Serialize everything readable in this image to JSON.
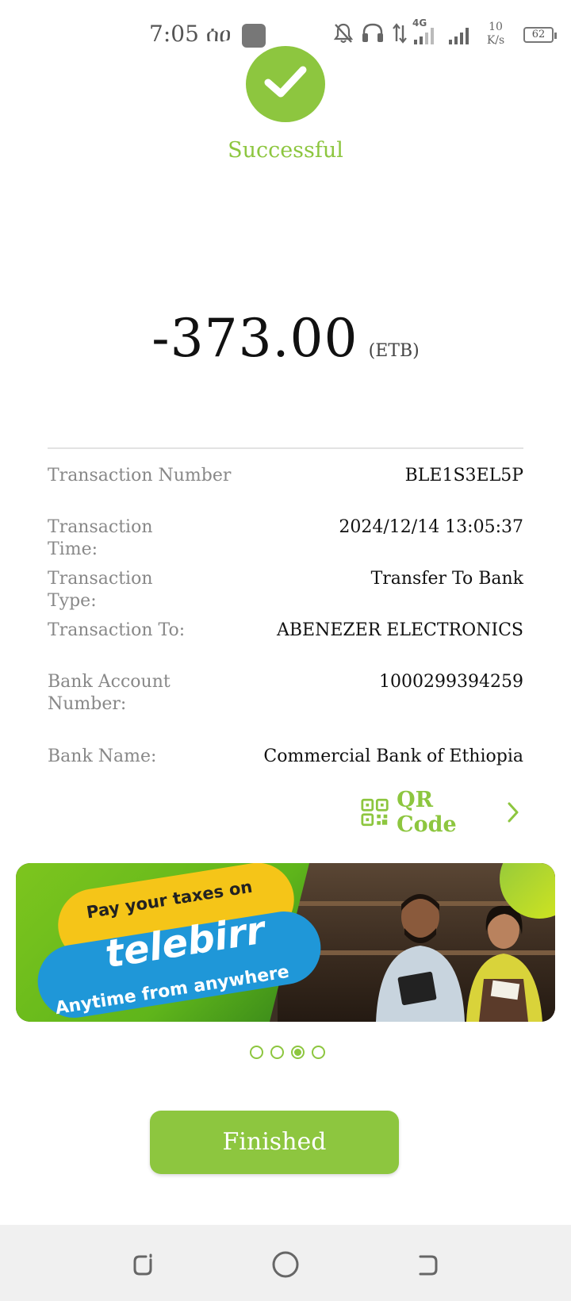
{
  "status_bar": {
    "time": "7:05 ꀀ",
    "time_text": "7:05 ሰዐ",
    "network_type": "4G",
    "speed_value": "10",
    "speed_unit": "K/s",
    "battery": "62"
  },
  "result": {
    "status": "Successful",
    "amount": "-373.00",
    "currency": "(ETB)"
  },
  "details": [
    {
      "label": "Transaction Number",
      "value": "BLE1S3EL5P"
    },
    {
      "label": "Transaction Time:",
      "value": "2024/12/14 13:05:37"
    },
    {
      "label": "Transaction Type:",
      "value": "Transfer To Bank"
    },
    {
      "label": "Transaction To:",
      "value": "ABENEZER ELECTRONICS"
    },
    {
      "label": "Bank Account Number:",
      "value": "1000299394259"
    },
    {
      "label": "Bank Name:",
      "value": "Commercial Bank of Ethiopia"
    }
  ],
  "qr": {
    "label": "QR Code"
  },
  "banner": {
    "line1": "Pay your taxes on",
    "brand": "telebirr",
    "line3": "Anytime from anywhere"
  },
  "pager": {
    "count": 4,
    "active_index": 2
  },
  "actions": {
    "finished_label": "Finished"
  },
  "colors": {
    "accent": "#8dc63f",
    "label_gray": "#888888",
    "value_dark": "#111111"
  },
  "icons": {
    "success": "checkmark-icon",
    "qr": "qr-code-icon",
    "chevron": "chevron-right-icon",
    "nav_recents": "recents-icon",
    "nav_home": "home-icon",
    "nav_back": "back-icon"
  }
}
